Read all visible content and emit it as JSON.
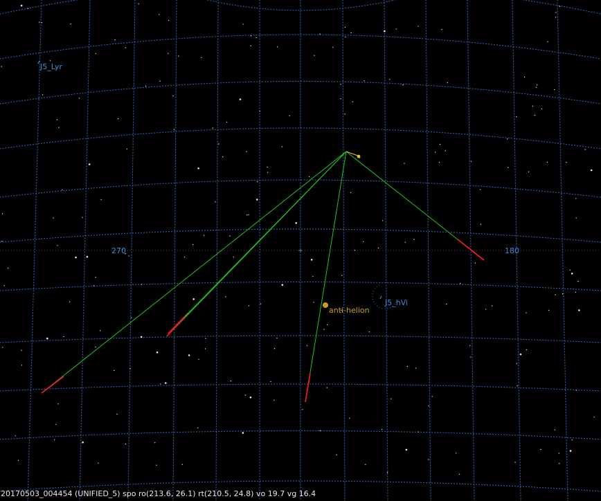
{
  "view": {
    "az_label_left": "270",
    "az_label_right": "180"
  },
  "radiants": {
    "lyr": "J5_Lyr",
    "hvi": "J5_hVi"
  },
  "anti_helion": {
    "label": "anti-helion",
    "color": "#c8a020"
  },
  "status": {
    "text": "20170503_004454 (UNIFIED_5) spo ro(213.6, 26.1) rt(210.5, 24.8) vo 19.7 vg 16.4"
  },
  "colors": {
    "grid": "#2a5fa8",
    "label": "#3a8fd8",
    "trail_projection": "#22c422",
    "meteor": "#e41e1e",
    "background": "#000000"
  }
}
